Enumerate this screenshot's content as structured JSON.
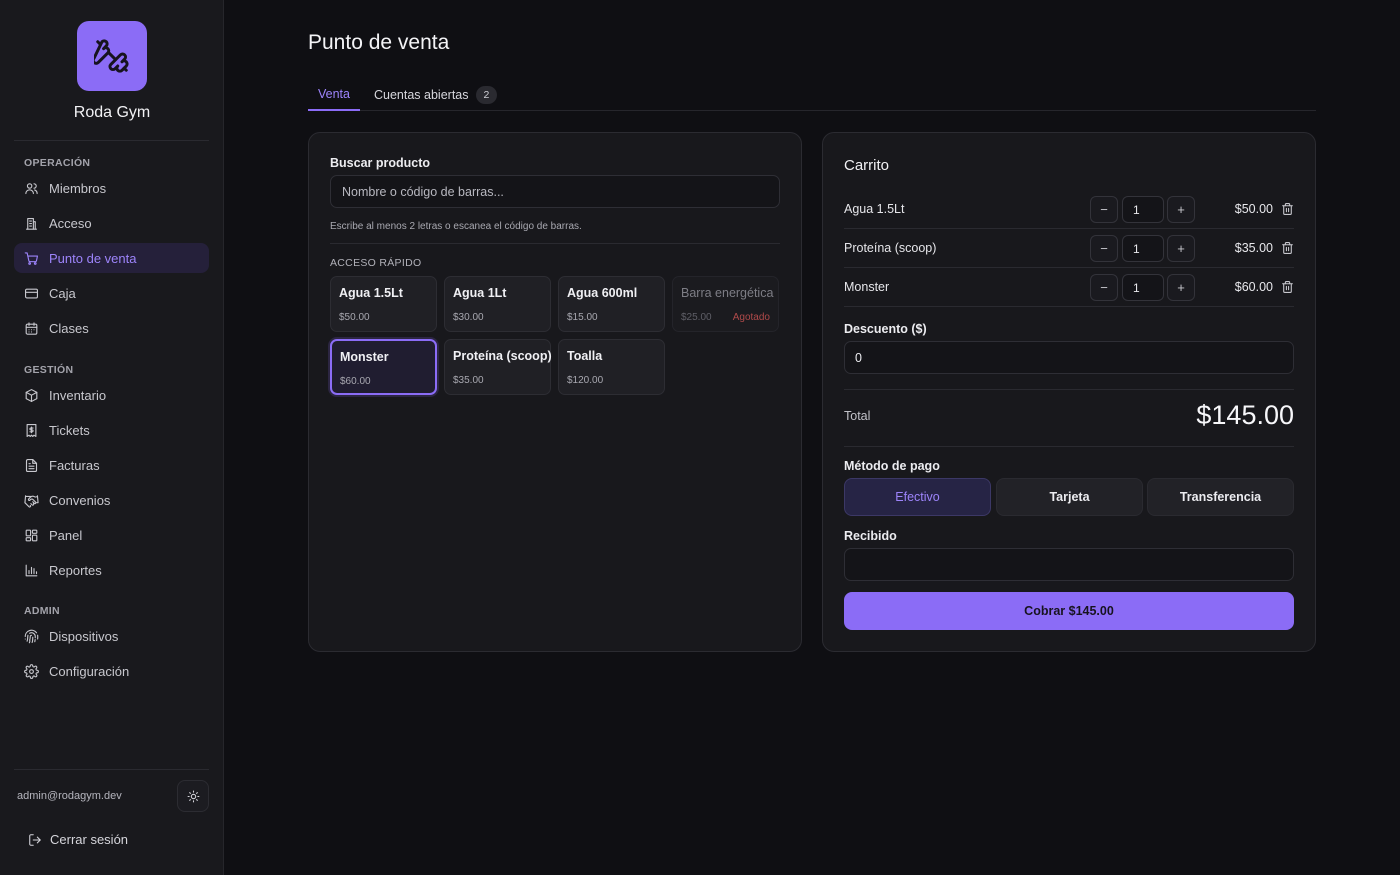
{
  "sidebar": {
    "brand": "Roda Gym",
    "sections": [
      {
        "label": "OPERACIÓN",
        "items": [
          {
            "label": "Miembros",
            "icon": "users-icon"
          },
          {
            "label": "Acceso",
            "icon": "building-icon"
          },
          {
            "label": "Punto de venta",
            "icon": "cart-icon",
            "active": true
          },
          {
            "label": "Caja",
            "icon": "credit-card-icon"
          },
          {
            "label": "Clases",
            "icon": "calendar-icon"
          }
        ]
      },
      {
        "label": "GESTIÓN",
        "items": [
          {
            "label": "Inventario",
            "icon": "box-icon"
          },
          {
            "label": "Tickets",
            "icon": "receipt-icon"
          },
          {
            "label": "Facturas",
            "icon": "file-text-icon"
          },
          {
            "label": "Convenios",
            "icon": "handshake-icon"
          },
          {
            "label": "Panel",
            "icon": "dashboard-icon"
          },
          {
            "label": "Reportes",
            "icon": "bar-chart-icon"
          }
        ]
      },
      {
        "label": "ADMIN",
        "items": [
          {
            "label": "Dispositivos",
            "icon": "fingerprint-icon"
          },
          {
            "label": "Configuración",
            "icon": "gear-icon"
          }
        ]
      }
    ],
    "user_email": "admin@rodagym.dev",
    "logout_label": "Cerrar sesión"
  },
  "page": {
    "title": "Punto de venta",
    "tabs": [
      {
        "label": "Venta",
        "active": true
      },
      {
        "label": "Cuentas abiertas",
        "count": "2"
      }
    ]
  },
  "search": {
    "label": "Buscar producto",
    "placeholder": "Nombre o código de barras...",
    "hint": "Escribe al menos 2 letras o escanea el código de barras."
  },
  "quick_access": {
    "label": "ACCESO RÁPIDO",
    "products": [
      {
        "name": "Agua 1.5Lt",
        "price": "$50.00"
      },
      {
        "name": "Agua 1Lt",
        "price": "$30.00"
      },
      {
        "name": "Agua 600ml",
        "price": "$15.00"
      },
      {
        "name": "Barra energética",
        "price": "$25.00",
        "status": "Agotado",
        "disabled": true
      },
      {
        "name": "Monster",
        "price": "$60.00",
        "selected": true
      },
      {
        "name": "Proteína (scoop)",
        "price": "$35.00"
      },
      {
        "name": "Toalla",
        "price": "$120.00"
      }
    ]
  },
  "cart": {
    "title": "Carrito",
    "items": [
      {
        "name": "Agua 1.5Lt",
        "qty": "1",
        "total": "$50.00"
      },
      {
        "name": "Proteína (scoop)",
        "qty": "1",
        "total": "$35.00"
      },
      {
        "name": "Monster",
        "qty": "1",
        "total": "$60.00"
      }
    ],
    "minus": "−",
    "plus": "+",
    "discount_label": "Descuento ($)",
    "discount_value": "0",
    "total_label": "Total",
    "total_value": "$145.00",
    "payment_label": "Método de pago",
    "payment_methods": [
      {
        "label": "Efectivo",
        "active": true
      },
      {
        "label": "Tarjeta"
      },
      {
        "label": "Transferencia"
      }
    ],
    "received_label": "Recibido",
    "received_value": "",
    "charge_label": "Cobrar $145.00"
  },
  "colors": {
    "accent": "#8b6cf6",
    "background": "#0f0f13",
    "sidebar": "#19191d",
    "danger": "#b04a4a"
  }
}
